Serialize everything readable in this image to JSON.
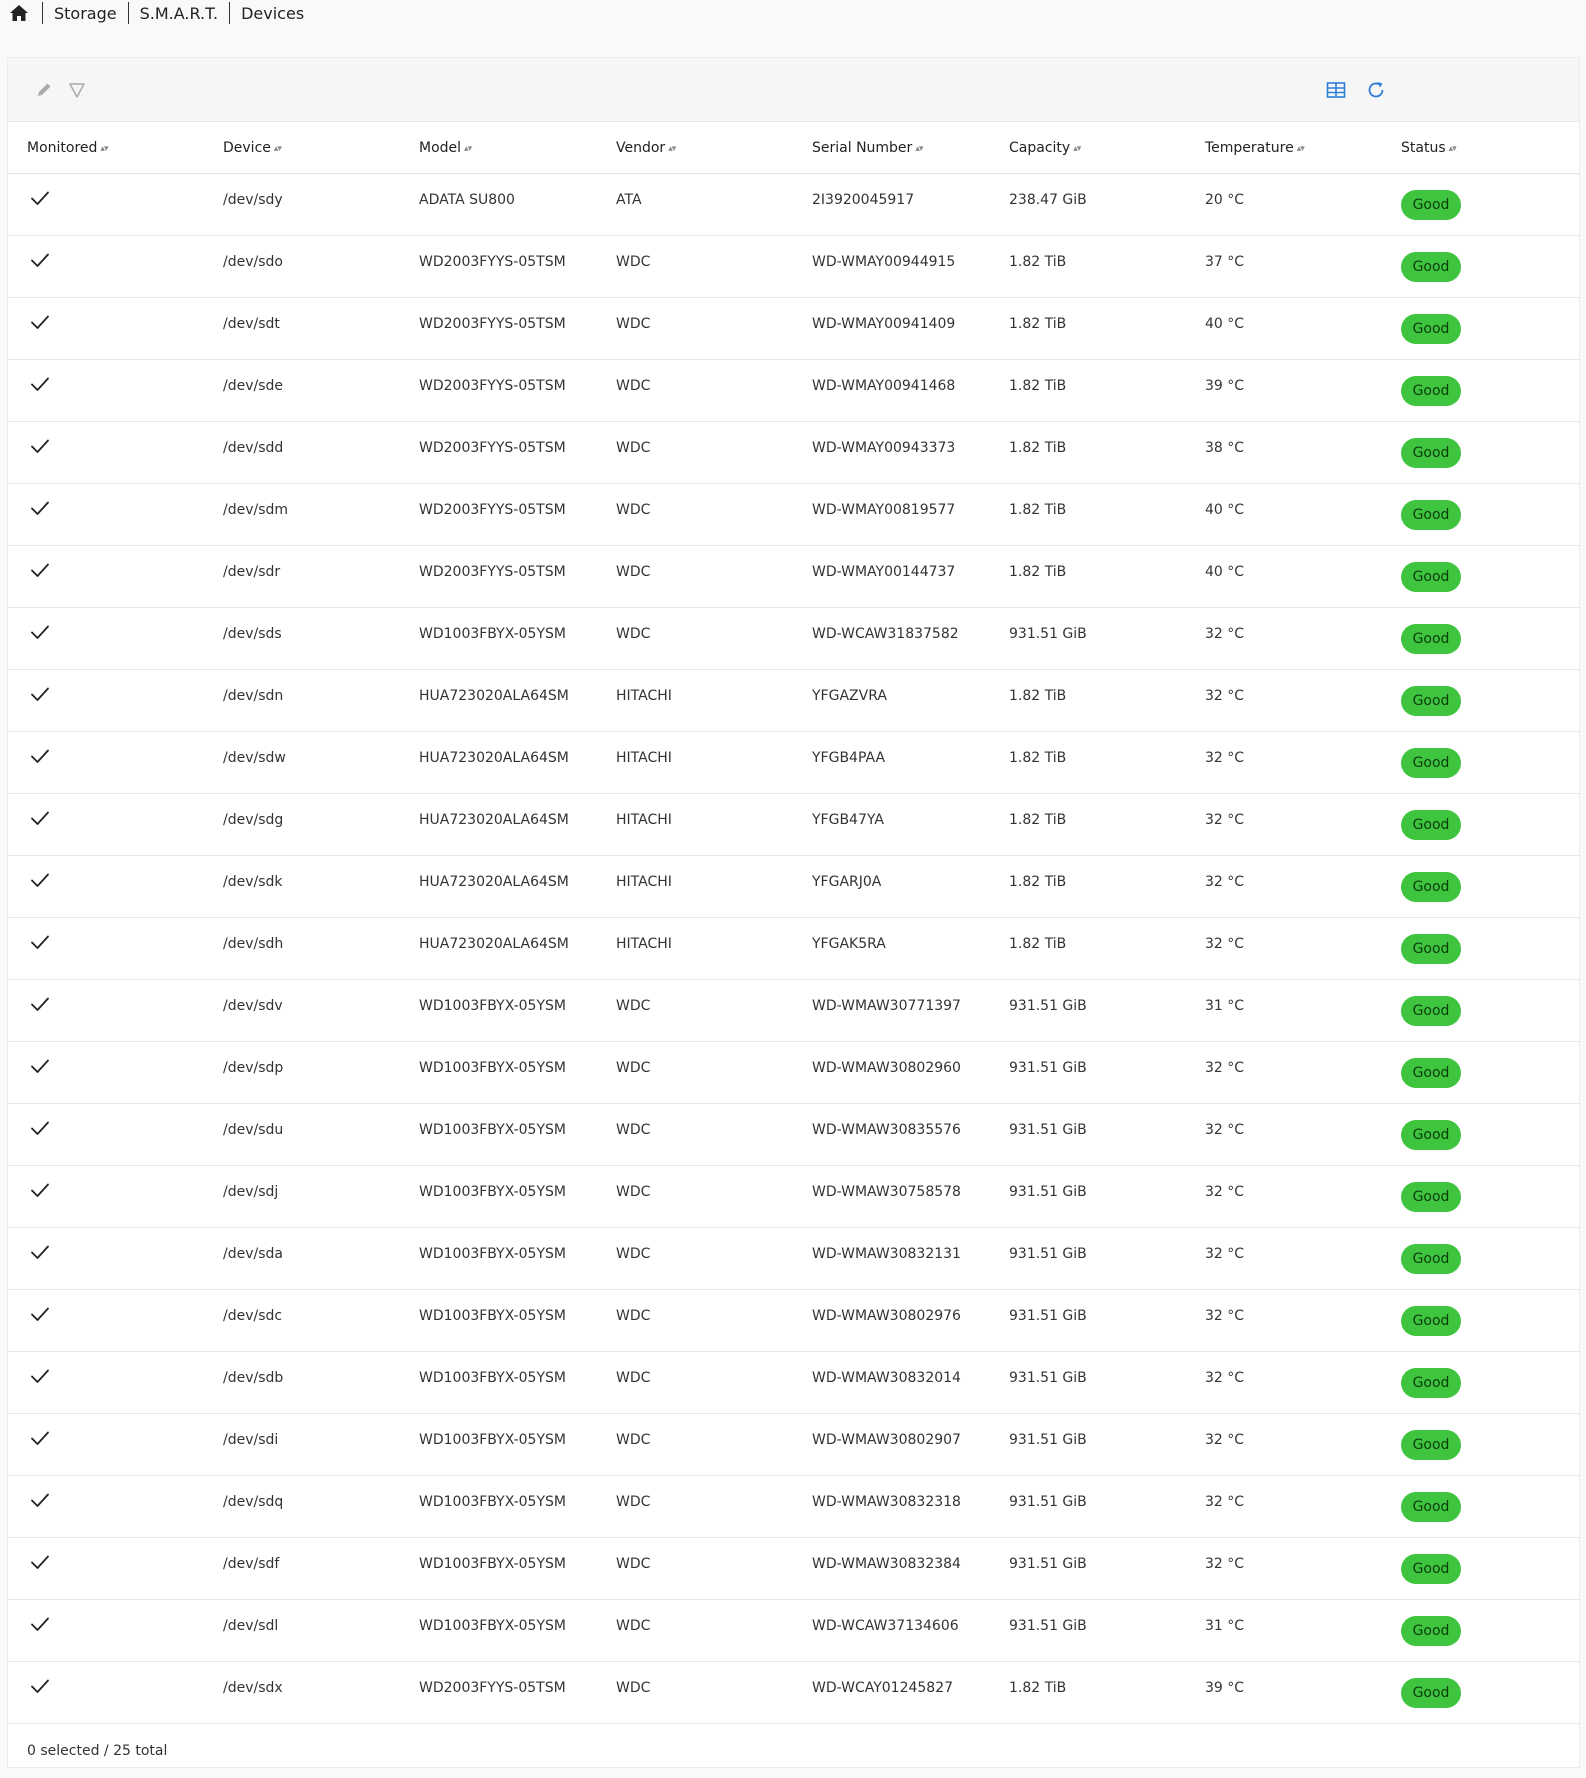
{
  "breadcrumb": {
    "items": [
      "Storage",
      "S.M.A.R.T.",
      "Devices"
    ]
  },
  "icons": {
    "home": "home-icon",
    "edit": "pencil-icon",
    "filter": "filter-icon",
    "columns": "table-columns-icon",
    "refresh": "refresh-icon",
    "monitored": "checkmark-icon"
  },
  "colors": {
    "status_good_bg": "#3ec43e",
    "accent": "#2e7fd6"
  },
  "table": {
    "columns": [
      "Monitored",
      "Device",
      "Model",
      "Vendor",
      "Serial Number",
      "Capacity",
      "Temperature",
      "Status"
    ],
    "rows": [
      {
        "monitored": true,
        "device": "/dev/sdy",
        "model": "ADATA SU800",
        "vendor": "ATA",
        "serial": "2I3920045917",
        "capacity": "238.47 GiB",
        "temperature": "20 °C",
        "status": "Good"
      },
      {
        "monitored": true,
        "device": "/dev/sdo",
        "model": "WD2003FYYS-05TSM",
        "vendor": "WDC",
        "serial": "WD-WMAY00944915",
        "capacity": "1.82 TiB",
        "temperature": "37 °C",
        "status": "Good"
      },
      {
        "monitored": true,
        "device": "/dev/sdt",
        "model": "WD2003FYYS-05TSM",
        "vendor": "WDC",
        "serial": "WD-WMAY00941409",
        "capacity": "1.82 TiB",
        "temperature": "40 °C",
        "status": "Good"
      },
      {
        "monitored": true,
        "device": "/dev/sde",
        "model": "WD2003FYYS-05TSM",
        "vendor": "WDC",
        "serial": "WD-WMAY00941468",
        "capacity": "1.82 TiB",
        "temperature": "39 °C",
        "status": "Good"
      },
      {
        "monitored": true,
        "device": "/dev/sdd",
        "model": "WD2003FYYS-05TSM",
        "vendor": "WDC",
        "serial": "WD-WMAY00943373",
        "capacity": "1.82 TiB",
        "temperature": "38 °C",
        "status": "Good"
      },
      {
        "monitored": true,
        "device": "/dev/sdm",
        "model": "WD2003FYYS-05TSM",
        "vendor": "WDC",
        "serial": "WD-WMAY00819577",
        "capacity": "1.82 TiB",
        "temperature": "40 °C",
        "status": "Good"
      },
      {
        "monitored": true,
        "device": "/dev/sdr",
        "model": "WD2003FYYS-05TSM",
        "vendor": "WDC",
        "serial": "WD-WMAY00144737",
        "capacity": "1.82 TiB",
        "temperature": "40 °C",
        "status": "Good"
      },
      {
        "monitored": true,
        "device": "/dev/sds",
        "model": "WD1003FBYX-05YSM",
        "vendor": "WDC",
        "serial": "WD-WCAW31837582",
        "capacity": "931.51 GiB",
        "temperature": "32 °C",
        "status": "Good"
      },
      {
        "monitored": true,
        "device": "/dev/sdn",
        "model": "HUA723020ALA64SM",
        "vendor": "HITACHI",
        "serial": "YFGAZVRA",
        "capacity": "1.82 TiB",
        "temperature": "32 °C",
        "status": "Good"
      },
      {
        "monitored": true,
        "device": "/dev/sdw",
        "model": "HUA723020ALA64SM",
        "vendor": "HITACHI",
        "serial": "YFGB4PAA",
        "capacity": "1.82 TiB",
        "temperature": "32 °C",
        "status": "Good"
      },
      {
        "monitored": true,
        "device": "/dev/sdg",
        "model": "HUA723020ALA64SM",
        "vendor": "HITACHI",
        "serial": "YFGB47YA",
        "capacity": "1.82 TiB",
        "temperature": "32 °C",
        "status": "Good"
      },
      {
        "monitored": true,
        "device": "/dev/sdk",
        "model": "HUA723020ALA64SM",
        "vendor": "HITACHI",
        "serial": "YFGARJ0A",
        "capacity": "1.82 TiB",
        "temperature": "32 °C",
        "status": "Good"
      },
      {
        "monitored": true,
        "device": "/dev/sdh",
        "model": "HUA723020ALA64SM",
        "vendor": "HITACHI",
        "serial": "YFGAK5RA",
        "capacity": "1.82 TiB",
        "temperature": "32 °C",
        "status": "Good"
      },
      {
        "monitored": true,
        "device": "/dev/sdv",
        "model": "WD1003FBYX-05YSM",
        "vendor": "WDC",
        "serial": "WD-WMAW30771397",
        "capacity": "931.51 GiB",
        "temperature": "31 °C",
        "status": "Good"
      },
      {
        "monitored": true,
        "device": "/dev/sdp",
        "model": "WD1003FBYX-05YSM",
        "vendor": "WDC",
        "serial": "WD-WMAW30802960",
        "capacity": "931.51 GiB",
        "temperature": "32 °C",
        "status": "Good"
      },
      {
        "monitored": true,
        "device": "/dev/sdu",
        "model": "WD1003FBYX-05YSM",
        "vendor": "WDC",
        "serial": "WD-WMAW30835576",
        "capacity": "931.51 GiB",
        "temperature": "32 °C",
        "status": "Good"
      },
      {
        "monitored": true,
        "device": "/dev/sdj",
        "model": "WD1003FBYX-05YSM",
        "vendor": "WDC",
        "serial": "WD-WMAW30758578",
        "capacity": "931.51 GiB",
        "temperature": "32 °C",
        "status": "Good"
      },
      {
        "monitored": true,
        "device": "/dev/sda",
        "model": "WD1003FBYX-05YSM",
        "vendor": "WDC",
        "serial": "WD-WMAW30832131",
        "capacity": "931.51 GiB",
        "temperature": "32 °C",
        "status": "Good"
      },
      {
        "monitored": true,
        "device": "/dev/sdc",
        "model": "WD1003FBYX-05YSM",
        "vendor": "WDC",
        "serial": "WD-WMAW30802976",
        "capacity": "931.51 GiB",
        "temperature": "32 °C",
        "status": "Good"
      },
      {
        "monitored": true,
        "device": "/dev/sdb",
        "model": "WD1003FBYX-05YSM",
        "vendor": "WDC",
        "serial": "WD-WMAW30832014",
        "capacity": "931.51 GiB",
        "temperature": "32 °C",
        "status": "Good"
      },
      {
        "monitored": true,
        "device": "/dev/sdi",
        "model": "WD1003FBYX-05YSM",
        "vendor": "WDC",
        "serial": "WD-WMAW30802907",
        "capacity": "931.51 GiB",
        "temperature": "32 °C",
        "status": "Good"
      },
      {
        "monitored": true,
        "device": "/dev/sdq",
        "model": "WD1003FBYX-05YSM",
        "vendor": "WDC",
        "serial": "WD-WMAW30832318",
        "capacity": "931.51 GiB",
        "temperature": "32 °C",
        "status": "Good"
      },
      {
        "monitored": true,
        "device": "/dev/sdf",
        "model": "WD1003FBYX-05YSM",
        "vendor": "WDC",
        "serial": "WD-WMAW30832384",
        "capacity": "931.51 GiB",
        "temperature": "32 °C",
        "status": "Good"
      },
      {
        "monitored": true,
        "device": "/dev/sdl",
        "model": "WD1003FBYX-05YSM",
        "vendor": "WDC",
        "serial": "WD-WCAW37134606",
        "capacity": "931.51 GiB",
        "temperature": "31 °C",
        "status": "Good"
      },
      {
        "monitored": true,
        "device": "/dev/sdx",
        "model": "WD2003FYYS-05TSM",
        "vendor": "WDC",
        "serial": "WD-WCAY01245827",
        "capacity": "1.82 TiB",
        "temperature": "39 °C",
        "status": "Good"
      }
    ]
  },
  "footer": {
    "summary": "0 selected / 25 total"
  }
}
